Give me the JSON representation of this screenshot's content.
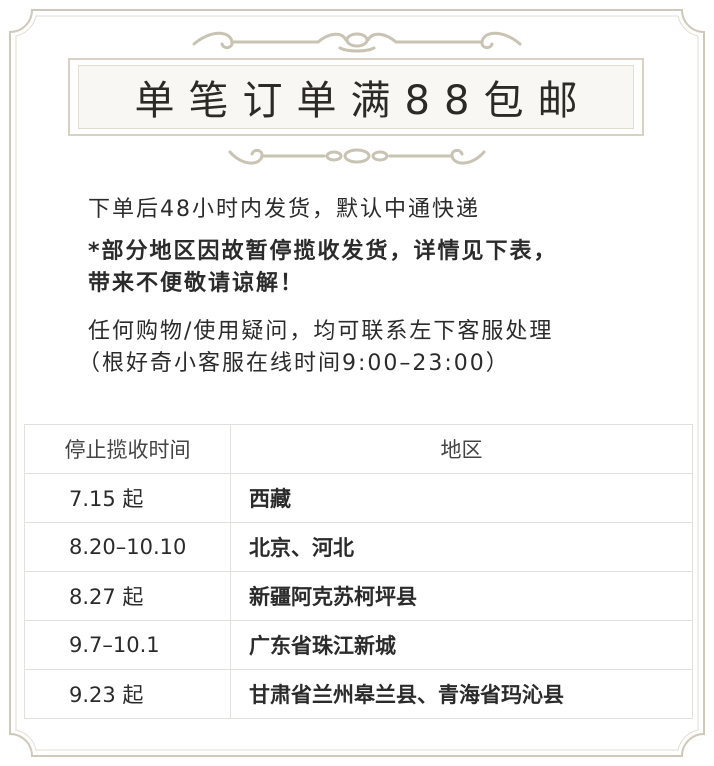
{
  "banner": {
    "title": "单笔订单满88包邮"
  },
  "notes": {
    "line1": "下单后48小时内发货，默认中通快递",
    "line2": "*部分地区因故暂停揽收发货，详情见下表，",
    "line3": "带来不便敬请谅解！",
    "line4": "任何购物/使用疑问，均可联系左下客服处理",
    "line5": "（根好奇小客服在线时间9:00–23:00）"
  },
  "table": {
    "headers": [
      "停止揽收时间",
      "地区"
    ],
    "rows": [
      {
        "time": "7.15 起",
        "region": "西藏"
      },
      {
        "time": "8.20–10.10",
        "region": "北京、河北"
      },
      {
        "time": "8.27 起",
        "region": "新疆阿克苏柯坪县"
      },
      {
        "time": "9.7–10.1",
        "region": "广东省珠江新城"
      },
      {
        "time": "9.23 起",
        "region": "甘肃省兰州皋兰县、青海省玛沁县"
      }
    ]
  },
  "colors": {
    "frame": "#d8d2c4",
    "banner_bg": "#f8f7f3",
    "ornament": "#c9c3b3",
    "text": "#2b2b2b"
  }
}
